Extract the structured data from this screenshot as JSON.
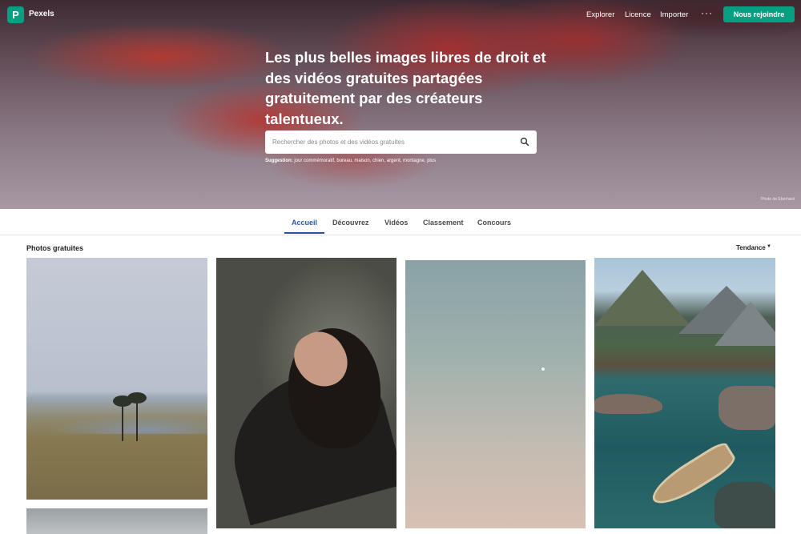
{
  "nav": {
    "logo_letter": "P",
    "brand": "Pexels",
    "links": [
      "Explorer",
      "Licence",
      "Importer"
    ],
    "more": "···",
    "join": "Nous rejoindre"
  },
  "hero": {
    "title": "Les plus belles images libres de droit et des vidéos gratuites partagées gratuitement par des créateurs talentueux.",
    "search_placeholder": "Rechercher des photos et des vidéos gratuites",
    "suggestions_label": "Suggestion:",
    "suggestions": "jour commémoratif, bureau, maison, chien, argent, montagne, plus",
    "credit": "Photo de Eberhard"
  },
  "tabs": [
    "Accueil",
    "Découvrez",
    "Vidéos",
    "Classement",
    "Concours"
  ],
  "active_tab": "Accueil",
  "section_title": "Photos gratuites",
  "sort": {
    "label": "Tendance"
  },
  "colors": {
    "brand": "#05a081",
    "active_tab": "#2a55a6"
  }
}
